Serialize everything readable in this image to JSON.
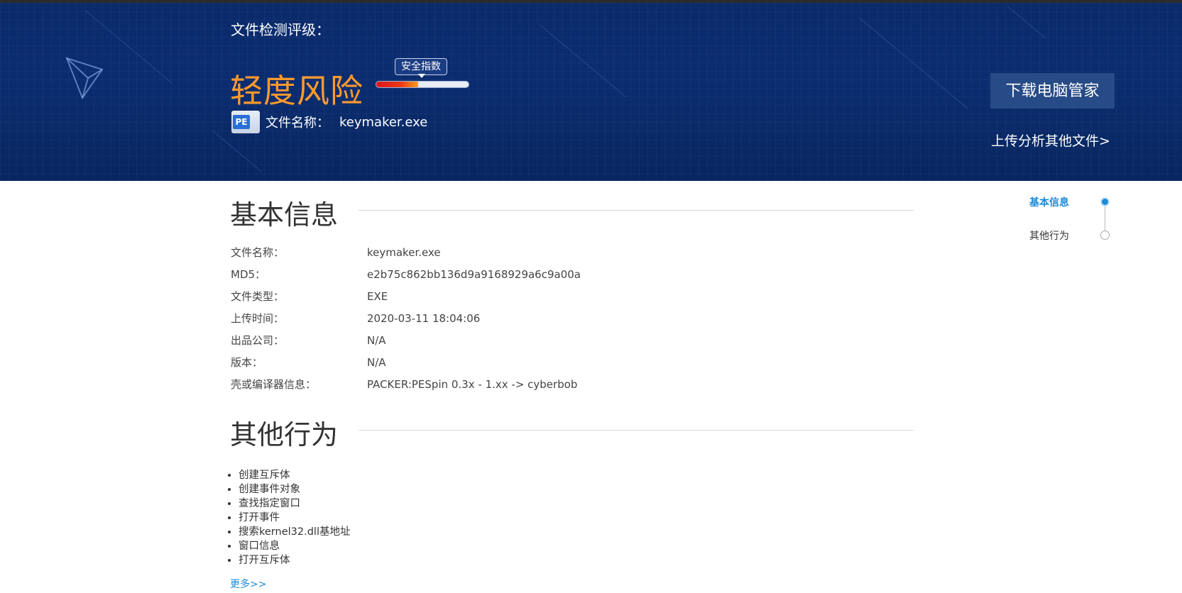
{
  "header": {
    "rating_label": "文件检测评级：",
    "risk_level": "轻度风险",
    "safety_index_label": "安全指数",
    "safety_index_fill": 0.45,
    "file_icon_label": "PE",
    "file_name_label": "文件名称：",
    "file_name_value": "keymaker.exe",
    "download_button": "下载电脑管家",
    "upload_link": "上传分析其他文件>"
  },
  "basic_info": {
    "title": "基本信息",
    "rows": [
      {
        "key": "文件名称：",
        "value": "keymaker.exe"
      },
      {
        "key": "MD5：",
        "value": "e2b75c862bb136d9a9168929a6c9a00a"
      },
      {
        "key": "文件类型：",
        "value": "EXE"
      },
      {
        "key": "上传时间：",
        "value": "2020-03-11 18:04:06"
      },
      {
        "key": "出品公司：",
        "value": "N/A"
      },
      {
        "key": "版本：",
        "value": "N/A"
      },
      {
        "key": "壳或编译器信息：",
        "value": "PACKER:PESpin 0.3x - 1.xx -> cyberbob"
      }
    ]
  },
  "other_behavior": {
    "title": "其他行为",
    "items": [
      "创建互斥体",
      "创建事件对象",
      "查找指定窗口",
      "打开事件",
      "搜索kernel32.dll基地址",
      "窗口信息",
      "打开互斥体"
    ],
    "more_link": "更多>>"
  },
  "side_nav": {
    "items": [
      {
        "label": "基本信息",
        "active": true
      },
      {
        "label": "其他行为",
        "active": false
      }
    ]
  },
  "colors": {
    "header_bg": "#0b2d70",
    "risk_orange": "#ff9a2e",
    "accent_blue": "#1a8ad9",
    "button_bg": "#274b86"
  }
}
